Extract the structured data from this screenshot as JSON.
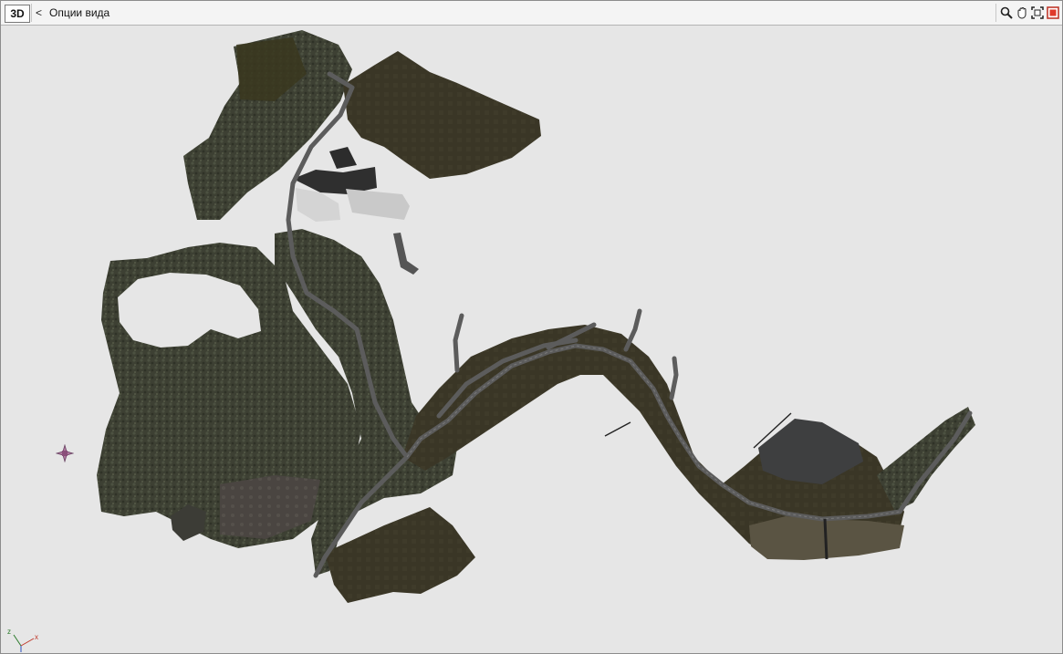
{
  "toolbar": {
    "mode_button_label": "3D",
    "view_options_chevron": "<",
    "view_options_label": "Опции вида",
    "tools": [
      {
        "name": "zoom-icon"
      },
      {
        "name": "pan-hand-icon"
      },
      {
        "name": "fit-extents-icon"
      },
      {
        "name": "stop-icon"
      }
    ]
  },
  "viewport": {
    "background_color": "#e6e6e6",
    "terrain_color": "#3a3626",
    "vegetation_color": "#3f4234",
    "road_color": "#595959",
    "building_color": "#cfcfcf",
    "marker_icon": "target-marker-icon"
  },
  "axes": {
    "z_label": "z",
    "x_label": "x",
    "z_color": "#2a7a2a",
    "x_color": "#c0392b"
  }
}
